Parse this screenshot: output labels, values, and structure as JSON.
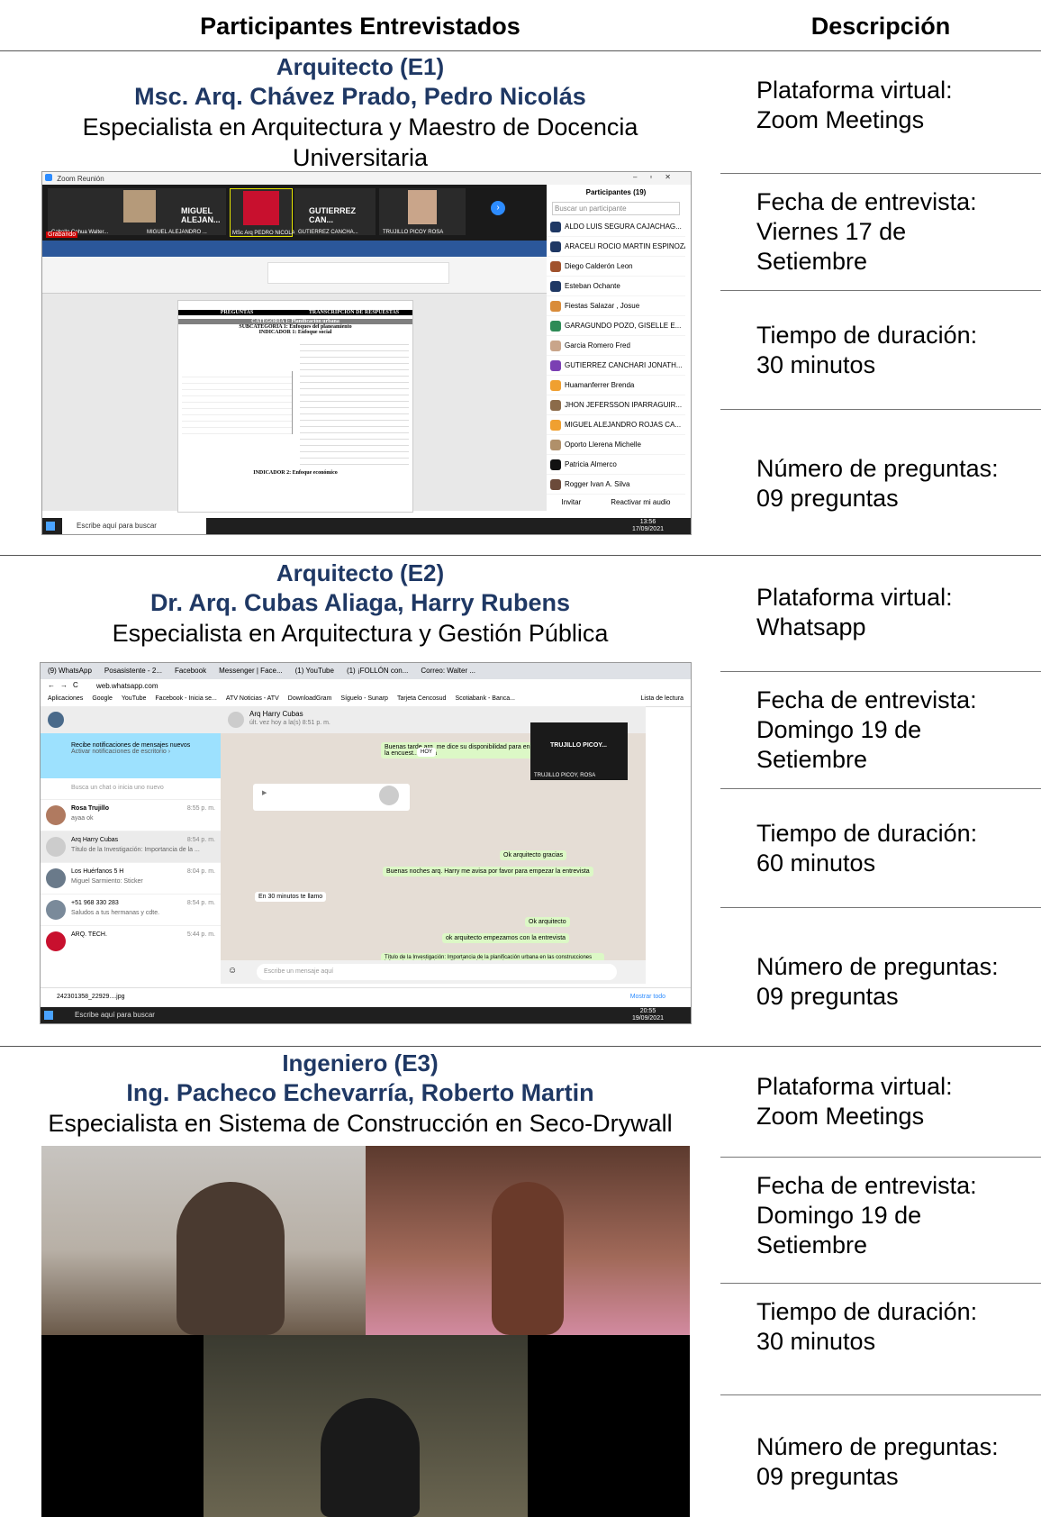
{
  "header": {
    "col1": "Participantes Entrevistados",
    "col2": "Descripción"
  },
  "rows": [
    {
      "role": "Arquitecto (E1)",
      "name": "Msc. Arq. Chávez Prado, Pedro Nicolás",
      "spec_line1": "Especialista en Arquitectura y Maestro de Docencia",
      "spec_line2": "Universitaria",
      "platform_label": "Plataforma virtual:",
      "platform_value": "Zoom Meetings",
      "date_label": "Fecha de entrevista:",
      "date_line1": "Viernes 17 de",
      "date_line2": "Setiembre",
      "duration_label": "Tiempo de duración:",
      "duration_value": "30 minutos",
      "questions_label": "Número de preguntas:",
      "questions_value": "09 preguntas",
      "screenshot": {
        "window_title": "Zoom Reunión",
        "tiles": [
          "MIGUEL ALEJAN...",
          "GUTIERREZ CAN..."
        ],
        "tile_subs": [
          "Cabello Cohua Walter...",
          "MIGUEL ALEJANDRO ...",
          "MSc Arq PEDRO NICOLA...",
          "GUTIERREZ CANCHA...",
          "TRUJILLO PICOY ROSA"
        ],
        "recording": "Grabando",
        "panel_title": "Participantes (19)",
        "search_placeholder": "Buscar un participante",
        "participants": [
          "ALDO LUIS SEGURA CAJACHAG...",
          "ARACELI ROCIO MARTIN ESPINOZA",
          "Diego Calderón Leon",
          "Esteban Ochante",
          "Fiestas Salazar , Josue",
          "GARAGUNDO POZO, GISELLE E...",
          "Garcia Romero Fred",
          "GUTIERREZ CANCHARI JONATH...",
          "Huamanferrer Brenda",
          "JHON JEFERSSON IPARRAGUIR...",
          "MIGUEL ALEJANDRO ROJAS CA...",
          "Oporto Llerena Michelle",
          "Patricia Almerco",
          "Rogger Ivan A. Silva"
        ],
        "invite": "Invitar",
        "reactivate": "Reactivar mi audio",
        "doc_col1": "PREGUNTAS",
        "doc_col2": "TRANSCRIPCIÓN DE RESPUESTAS",
        "doc_cat": "CATEGORIA 1: Planificación urbana",
        "doc_sub": "SUBCATEGORIA 1: Enfoques del planeamiento",
        "doc_ind": "INDICADOR 1: Enfoque social",
        "doc_ind2": "INDICADOR 2: Enfoque económico",
        "search_bar": "Escribe aquí para buscar",
        "clock": "13:56",
        "clock_date": "17/09/2021"
      }
    },
    {
      "role": "Arquitecto (E2)",
      "name": "Dr. Arq. Cubas Aliaga, Harry Rubens",
      "spec_line1": "Especialista en Arquitectura y Gestión Pública",
      "platform_label": "Plataforma virtual:",
      "platform_value": "Whatsapp",
      "date_label": "Fecha de entrevista:",
      "date_line1": "Domingo 19 de",
      "date_line2": "Setiembre",
      "duration_label": "Tiempo de duración:",
      "duration_value": "60 minutos",
      "questions_label": "Número de preguntas:",
      "questions_value": "09 preguntas",
      "screenshot": {
        "tabs": [
          "(9) WhatsApp",
          "Posasistente - 2...",
          "Facebook",
          "Messenger | Face...",
          "(1) YouTube",
          "(1) ¡FOLLÓN con...",
          "Correo: Walter ..."
        ],
        "url": "web.whatsapp.com",
        "bookmarks": [
          "Aplicaciones",
          "Google",
          "YouTube",
          "Facebook - Inicia se...",
          "ATV Noticias - ATV",
          "DownloadGram",
          "Síguelo - Sunarp",
          "Tarjeta Cencosud",
          "Scotiabank - Banca...",
          "Lista de lectura"
        ],
        "notif_title": "Recibe notificaciones de mensajes nuevos",
        "notif_sub": "Activar notificaciones de escritorio ›",
        "chat_search": "Busca un chat o inicia uno nuevo",
        "chats": [
          {
            "name": "Rosa Trujillo",
            "msg": "ayaa ok",
            "time": "8:55 p. m."
          },
          {
            "name": "Arq Harry Cubas",
            "msg": "Título de la Investigación: Importancia de la ...",
            "time": "8:54 p. m."
          },
          {
            "name": "Los Huérfanos 5 H",
            "msg": "Miguel Sarmiento: Sticker",
            "time": "8:04 p. m."
          },
          {
            "name": "+51 968 330 283",
            "msg": "Saludos a tus hermanas y cdte.",
            "time": "8:54 p. m."
          },
          {
            "name": "ARQ. TECH.",
            "msg": "",
            "time": "5:44 p. m."
          }
        ],
        "contact": "Arq Harry Cubas",
        "last_seen": "últ. vez hoy a la(s) 8:51 p. m.",
        "msgs": [
          "Buenas tarde arq, me dice su disponibilidad para en la encuest... evista",
          "Ok arquitecto gracias",
          "Buenas noches arq. Harry me avisa por favor para empezar la entrevista",
          "En 30 minutos te llamo",
          "Ok arquitecto",
          "ok arquitecto empezamos con la entrevista",
          "Título de la Investigación: Importancia de la planificación urbana en las construcciones informales de viviendas en San Juan de Lurigancho"
        ],
        "hoy": "HOY",
        "video_label": "TRUJILLO PICOY...",
        "video_sub": "TRUJILLO PICOY, ROSA",
        "compose": "Escribe un mensaje aquí",
        "download": "242301358_22929....jpg",
        "show_all": "Mostrar todo",
        "search_bar": "Escribe aquí para buscar",
        "clock": "20:55",
        "clock_date": "19/09/2021"
      }
    },
    {
      "role": "Ingeniero (E3)",
      "name": "Ing. Pacheco Echevarría, Roberto Martin",
      "spec_line1": "Especialista en Sistema de Construcción en Seco-Drywall",
      "platform_label": "Plataforma virtual:",
      "platform_value": "Zoom Meetings",
      "date_label": "Fecha de entrevista:",
      "date_line1": "Domingo 19 de",
      "date_line2": "Setiembre",
      "duration_label": "Tiempo de duración:",
      "duration_value": "30 minutos",
      "questions_label": "Número de preguntas:",
      "questions_value": "09 preguntas"
    }
  ],
  "colors": {
    "heading_blue": "#1f3864",
    "zoom_blue": "#2d8cff",
    "word_blue": "#2b579a",
    "wa_green": "#dcf8c6"
  }
}
